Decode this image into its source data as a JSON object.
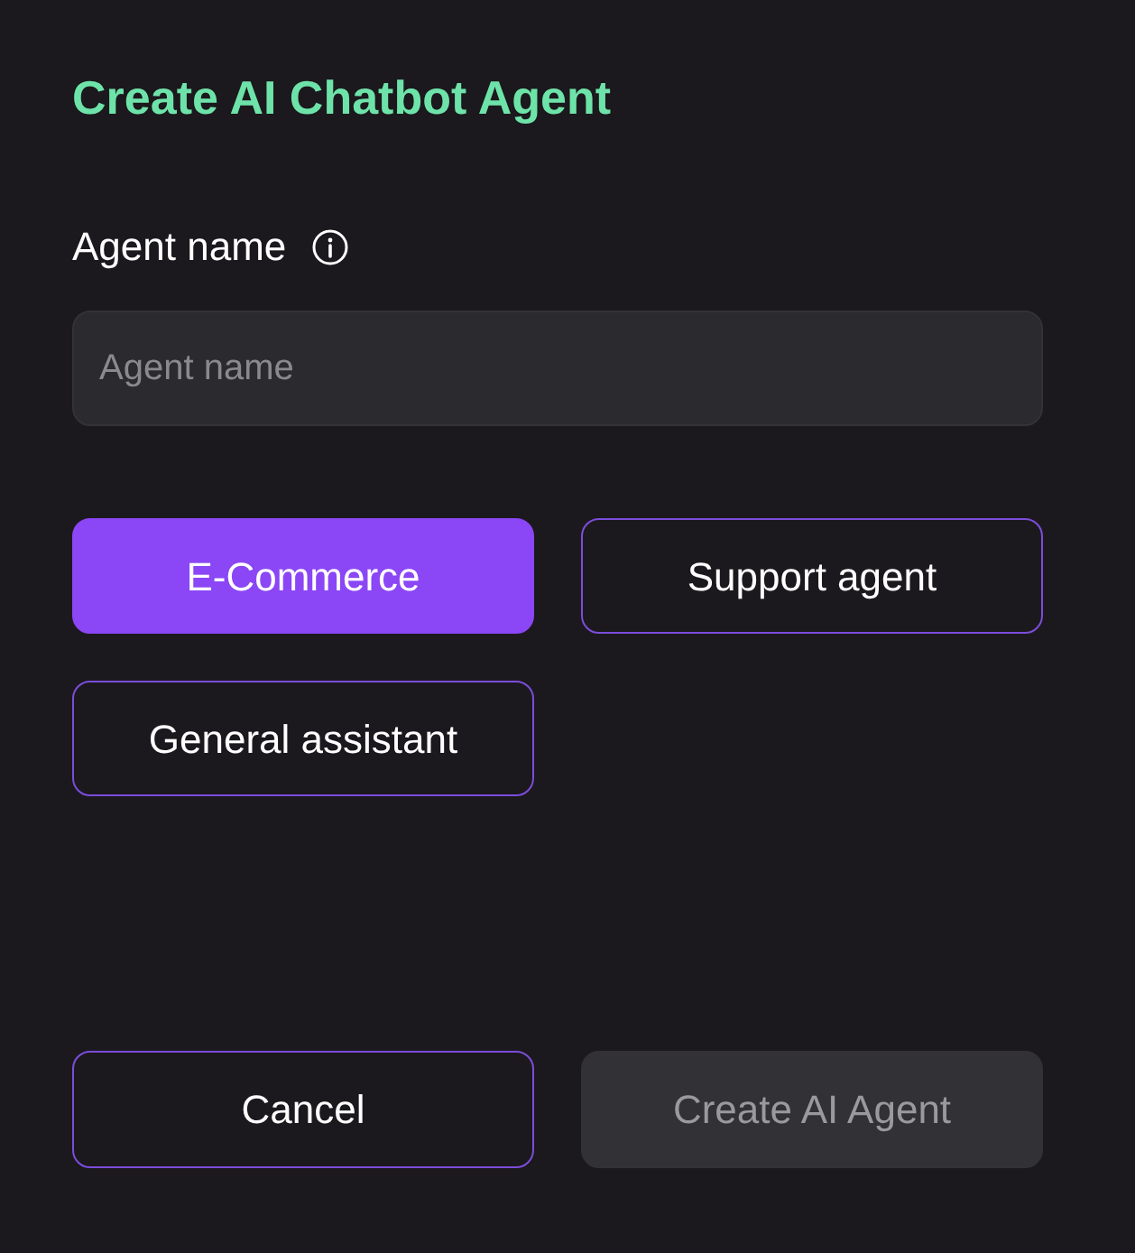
{
  "title": "Create AI Chatbot Agent",
  "agent_name": {
    "label": "Agent name",
    "placeholder": "Agent name"
  },
  "presets": [
    {
      "label": "E-Commerce",
      "selected": true
    },
    {
      "label": "Support agent",
      "selected": false
    },
    {
      "label": "General assistant",
      "selected": false
    }
  ],
  "actions": [
    {
      "kind": "secondary",
      "label": "Cancel",
      "disabled": false
    },
    {
      "kind": "primary",
      "label": "Create AI Agent",
      "disabled": true
    }
  ]
}
